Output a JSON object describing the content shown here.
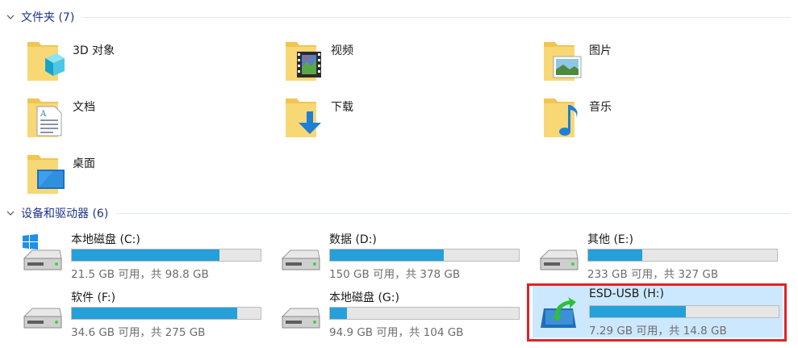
{
  "folders_group": {
    "title": "文件夹 (7)"
  },
  "folders": [
    {
      "label": "3D 对象",
      "icon": "3d-objects-folder-icon"
    },
    {
      "label": "视频",
      "icon": "videos-folder-icon"
    },
    {
      "label": "图片",
      "icon": "pictures-folder-icon"
    },
    {
      "label": "文档",
      "icon": "documents-folder-icon"
    },
    {
      "label": "下载",
      "icon": "downloads-folder-icon"
    },
    {
      "label": "音乐",
      "icon": "music-folder-icon"
    },
    {
      "label": "桌面",
      "icon": "desktop-folder-icon"
    }
  ],
  "drives_group": {
    "title": "设备和驱动器 (6)"
  },
  "drives": [
    {
      "name": "本地磁盘 (C:)",
      "info": "21.5 GB 可用，共 98.8 GB",
      "used_fraction": 0.782,
      "icon": "windows-drive-icon"
    },
    {
      "name": "数据 (D:)",
      "info": "150 GB 可用，共 378 GB",
      "used_fraction": 0.603,
      "icon": "hard-drive-icon"
    },
    {
      "name": "其他 (E:)",
      "info": "233 GB 可用，共 327 GB",
      "used_fraction": 0.287,
      "icon": "hard-drive-icon"
    },
    {
      "name": "软件 (F:)",
      "info": "34.6 GB 可用，共 275 GB",
      "used_fraction": 0.874,
      "icon": "hard-drive-icon"
    },
    {
      "name": "本地磁盘 (G:)",
      "info": "94.9 GB 可用，共 104 GB",
      "used_fraction": 0.088,
      "icon": "hard-drive-icon"
    },
    {
      "name": "ESD-USB (H:)",
      "info": "7.29 GB 可用，共 14.8 GB",
      "used_fraction": 0.507,
      "icon": "usb-drive-icon",
      "selected": true
    }
  ],
  "colors": {
    "accent": "#26a0da",
    "selection": "#cce8ff",
    "highlight_border": "#e02424",
    "group_title": "#1e3287"
  }
}
